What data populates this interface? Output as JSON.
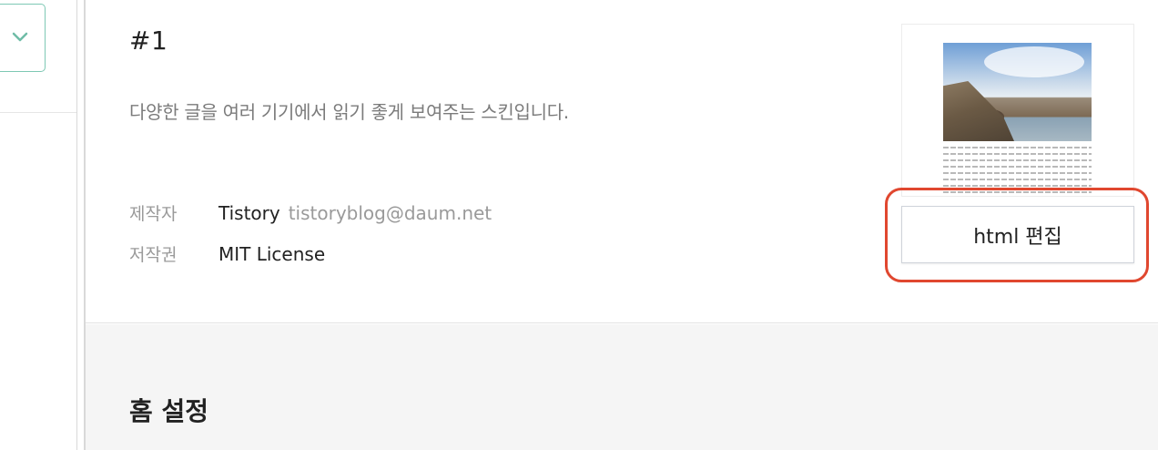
{
  "sidebar": {
    "dropdown_icon": "chevron-down-icon"
  },
  "skin": {
    "title": "#1",
    "description": "다양한 글을 여러 기기에서 읽기 좋게 보여주는 스킨입니다.",
    "author_label": "제작자",
    "author_name": "Tistory",
    "author_email": "tistoryblog@daum.net",
    "license_label": "저작권",
    "license_value": "MIT License",
    "edit_button_label": "html 편집"
  },
  "home_settings": {
    "title": "홈 설정"
  },
  "colors": {
    "highlight": "#e0472f",
    "accent": "#7ec8b4"
  }
}
